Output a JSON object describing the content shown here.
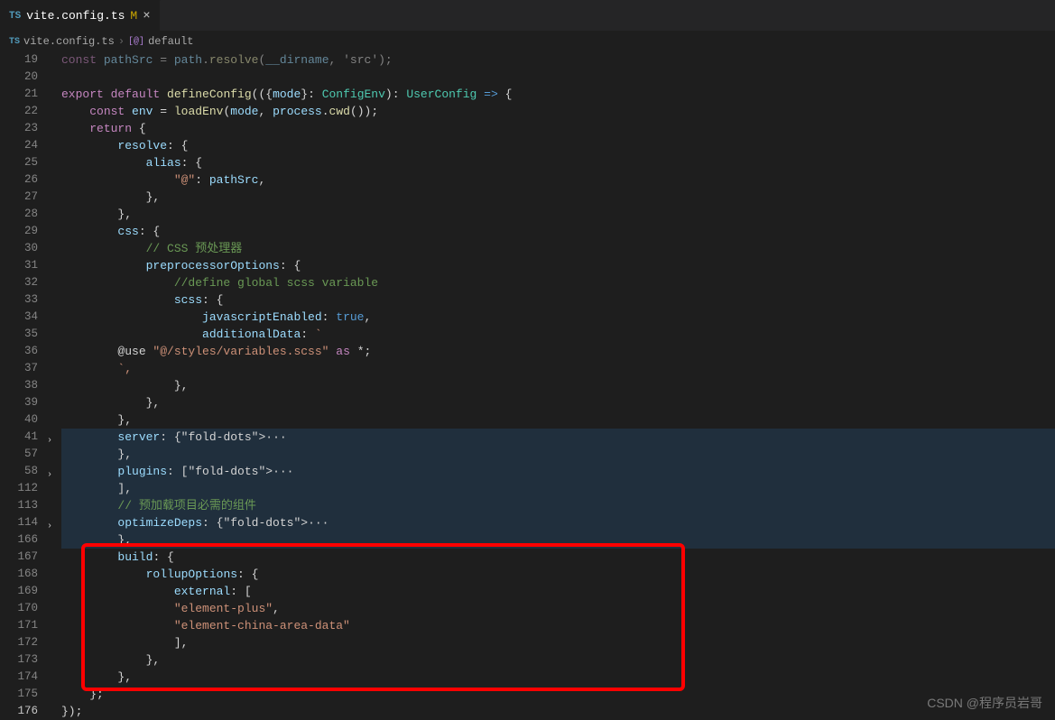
{
  "tab": {
    "icon": "TS",
    "filename": "vite.config.ts",
    "status": "M",
    "close": "×"
  },
  "breadcrumb": {
    "icon": "TS",
    "file": "vite.config.ts",
    "sep": "›",
    "symIcon": "[@]",
    "symbol": "default"
  },
  "lines": [
    {
      "n": 19,
      "t": "const pathSrc = path.resolve(__dirname, 'src');",
      "cls": "dim"
    },
    {
      "n": 20,
      "t": ""
    },
    {
      "n": 21,
      "t": "export default defineConfig(({mode}: ConfigEnv): UserConfig => {"
    },
    {
      "n": 22,
      "t": "    const env = loadEnv(mode, process.cwd());"
    },
    {
      "n": 23,
      "t": "    return {"
    },
    {
      "n": 24,
      "t": "        resolve: {"
    },
    {
      "n": 25,
      "t": "            alias: {"
    },
    {
      "n": 26,
      "t": "                \"@\": pathSrc,"
    },
    {
      "n": 27,
      "t": "            },"
    },
    {
      "n": 28,
      "t": "        },"
    },
    {
      "n": 29,
      "t": "        css: {"
    },
    {
      "n": 30,
      "t": "            // CSS 预处理器"
    },
    {
      "n": 31,
      "t": "            preprocessorOptions: {"
    },
    {
      "n": 32,
      "t": "                //define global scss variable"
    },
    {
      "n": 33,
      "t": "                scss: {"
    },
    {
      "n": 34,
      "t": "                    javascriptEnabled: true,"
    },
    {
      "n": 35,
      "t": "                    additionalData: `"
    },
    {
      "n": 36,
      "t": "        @use \"@/styles/variables.scss\" as *;"
    },
    {
      "n": 37,
      "t": "        `,"
    },
    {
      "n": 38,
      "t": "                },"
    },
    {
      "n": 39,
      "t": "            },"
    },
    {
      "n": 40,
      "t": "        },"
    },
    {
      "n": 41,
      "t": "        server: {···",
      "hl": true,
      "fold": true
    },
    {
      "n": 57,
      "t": "        },",
      "hl": true
    },
    {
      "n": 58,
      "t": "        plugins: [···",
      "hl": true,
      "fold": true
    },
    {
      "n": 112,
      "t": "        ],",
      "hl": true
    },
    {
      "n": 113,
      "t": "        // 预加载项目必需的组件",
      "hl": true
    },
    {
      "n": 114,
      "t": "        optimizeDeps: {···",
      "hl": true,
      "fold": true
    },
    {
      "n": 166,
      "t": "        },",
      "hl": true
    },
    {
      "n": 167,
      "t": "        build: {",
      "ch": true
    },
    {
      "n": 168,
      "t": "            rollupOptions: {",
      "ch": true
    },
    {
      "n": 169,
      "t": "                external: [",
      "ch": true
    },
    {
      "n": 170,
      "t": "                \"element-plus\",",
      "ch": true
    },
    {
      "n": 171,
      "t": "                \"element-china-area-data\"",
      "ch": true
    },
    {
      "n": 172,
      "t": "                ],",
      "ch": true
    },
    {
      "n": 173,
      "t": "            },",
      "ch": true
    },
    {
      "n": 174,
      "t": "        },",
      "ch": true
    },
    {
      "n": 175,
      "t": "    };"
    },
    {
      "n": 176,
      "t": "});"
    }
  ],
  "watermark": "CSDN @程序员岩哥",
  "highlightBox": {
    "startLine": 167,
    "endLine": 174
  }
}
